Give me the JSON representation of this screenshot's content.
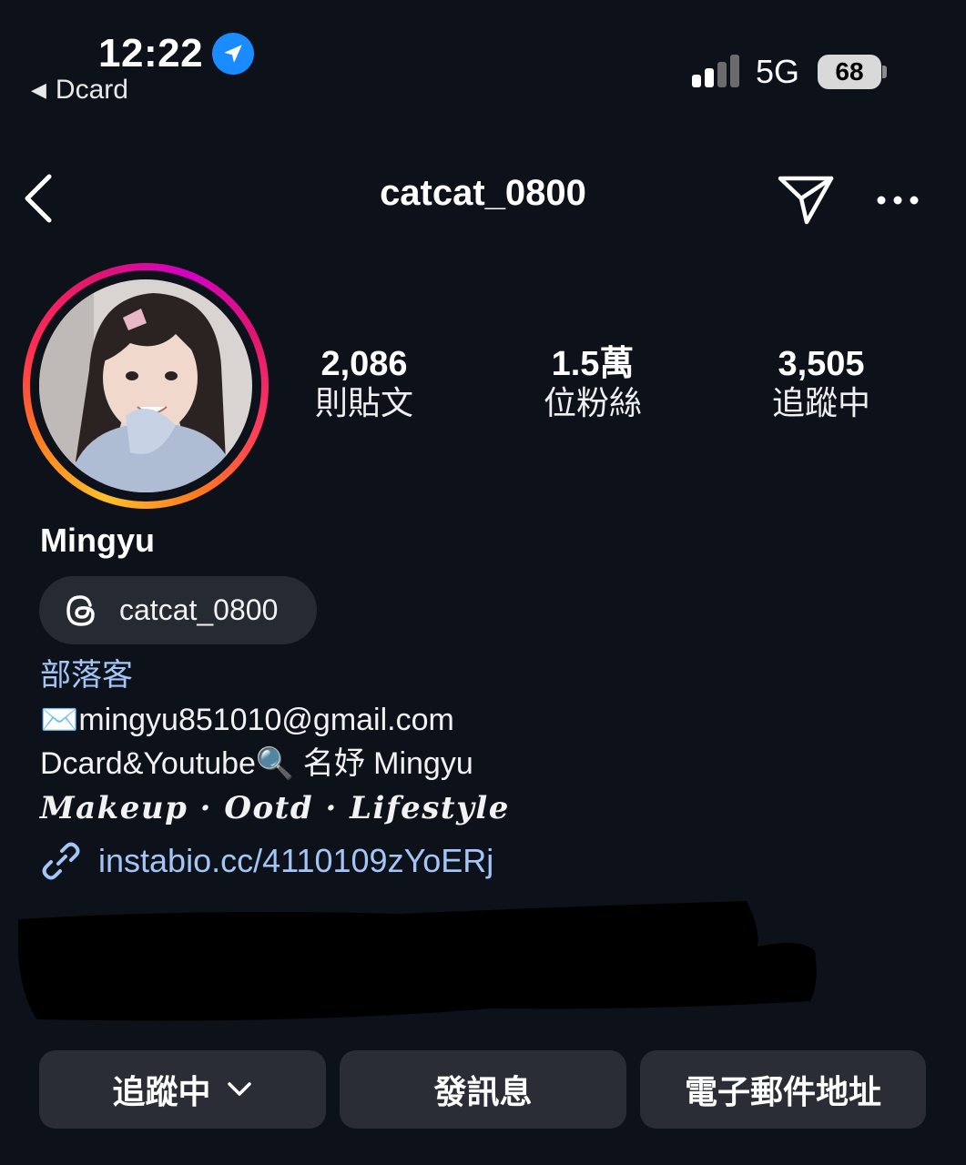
{
  "status_bar": {
    "time": "12:22",
    "back_app": "Dcard",
    "network": "5G",
    "battery": "68",
    "icons": [
      "location-icon",
      "signal-icon",
      "battery-icon"
    ]
  },
  "header": {
    "username": "catcat_0800",
    "icons": [
      "back-icon",
      "send-icon",
      "more-icon"
    ]
  },
  "profile": {
    "stats": [
      {
        "value": "2,086",
        "label": "則貼文"
      },
      {
        "value": "1.5萬",
        "label": "位粉絲"
      },
      {
        "value": "3,505",
        "label": "追蹤中"
      }
    ],
    "name": "Mingyu",
    "threads_handle": "catcat_0800",
    "category": "部落客",
    "bio_lines": [
      "✉️mingyu851010@gmail.com",
      "Dcard&Youtube🔍 名妤 Mingyu",
      "Makeup · Ootd · Lifestyle"
    ],
    "link": "instabio.cc/4110109zYoERj"
  },
  "actions": {
    "following": "追蹤中",
    "message": "發訊息",
    "email": "電子郵件地址"
  },
  "colors": {
    "background": "#0d111a",
    "link": "#a4c6f7",
    "button": "#2a2d35",
    "location_badge": "#1a8cff"
  }
}
